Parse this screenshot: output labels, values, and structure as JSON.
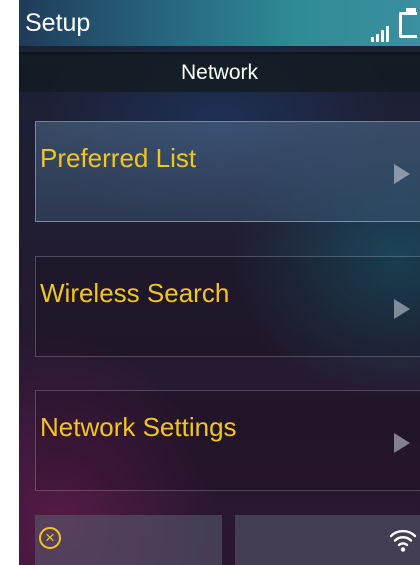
{
  "status_bar": {
    "title": "Setup",
    "signal_icon": "signal-bars-icon",
    "battery_icon": "battery-icon"
  },
  "header": {
    "title": "Network"
  },
  "menu": {
    "items": [
      {
        "label": "Preferred List",
        "selected": true,
        "icon": "chevron-right-icon"
      },
      {
        "label": "Wireless Search",
        "selected": false,
        "icon": "chevron-right-icon"
      },
      {
        "label": "Network Settings",
        "selected": false,
        "icon": "chevron-right-icon"
      }
    ]
  },
  "softkeys": {
    "left_icon": "cancel-icon",
    "right_icon": "wifi-icon"
  },
  "colors": {
    "accent": "#f2c61c",
    "text": "#ffffff"
  }
}
